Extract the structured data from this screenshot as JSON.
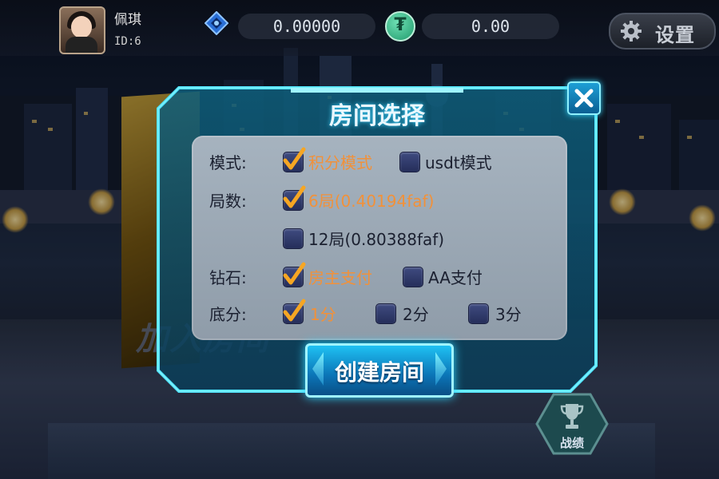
{
  "topbar": {
    "username": "佩琪",
    "user_id": "ID:6",
    "diamond_balance": "0.00000",
    "usdt_balance": "0.00",
    "usdt_symbol": "₮",
    "settings_label": "设置"
  },
  "background": {
    "poster_text": "加入房间"
  },
  "dialog": {
    "title": "房间选择",
    "mode": {
      "label": "模式:",
      "options": [
        {
          "label": "积分模式",
          "checked": true
        },
        {
          "label": "usdt模式",
          "checked": false
        }
      ]
    },
    "rounds": {
      "label": "局数:",
      "options": [
        {
          "label": "6局(0.40194faf)",
          "checked": true
        },
        {
          "label": "12局(0.80388faf)",
          "checked": false
        }
      ]
    },
    "diamond": {
      "label": "钻石:",
      "options": [
        {
          "label": "房主支付",
          "checked": true
        },
        {
          "label": "AA支付",
          "checked": false
        }
      ]
    },
    "base_score": {
      "label": "底分:",
      "options": [
        {
          "label": "1分",
          "checked": true
        },
        {
          "label": "2分",
          "checked": false
        },
        {
          "label": "3分",
          "checked": false
        }
      ]
    },
    "create_label": "创建房间"
  },
  "stats": {
    "label": "战绩"
  },
  "colors": {
    "accent_cyan": "#31d7ff",
    "selected_text": "#f1913a",
    "checkmark": "#f6a623"
  }
}
